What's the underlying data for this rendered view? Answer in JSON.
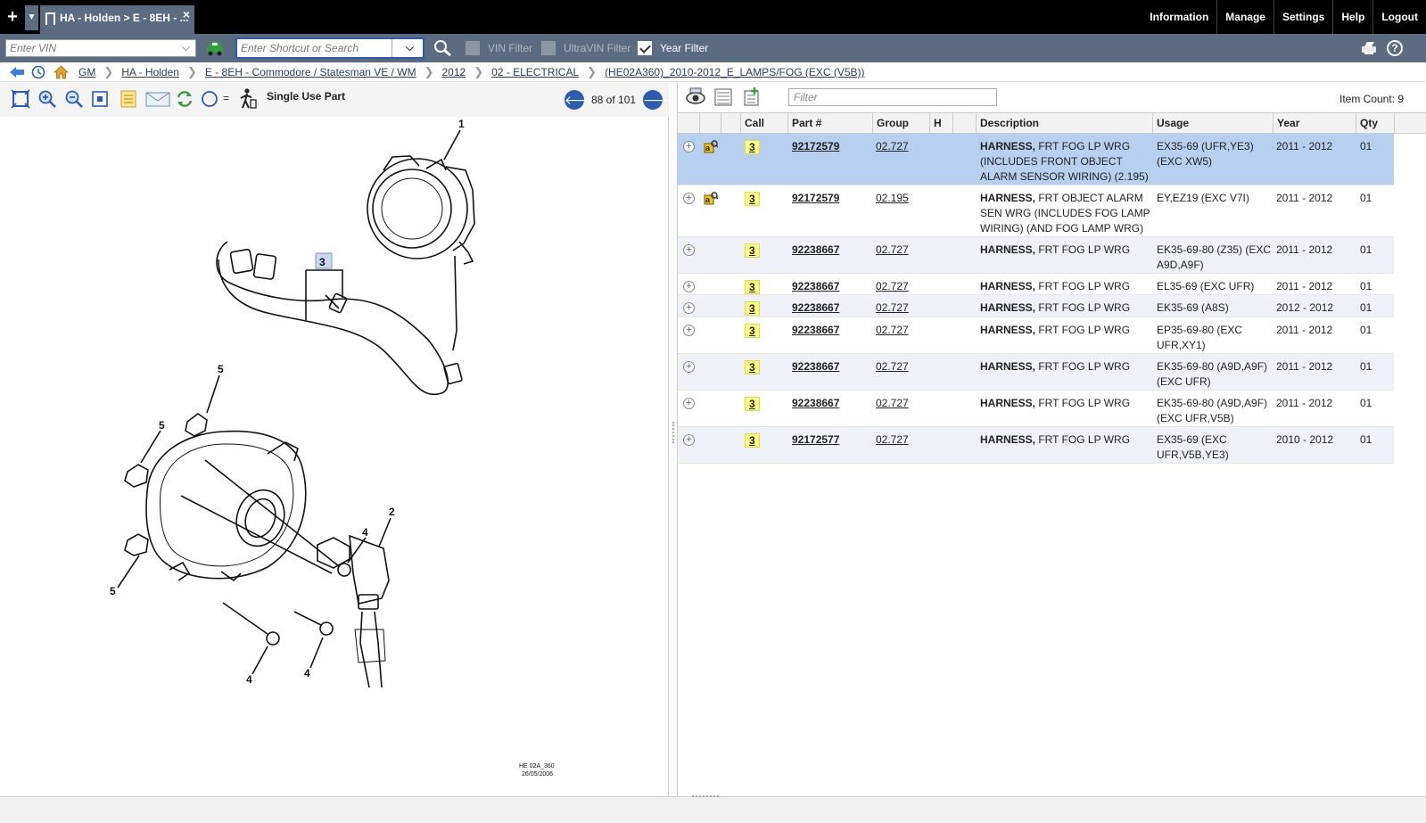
{
  "tab": {
    "title": "HA - Holden > E - 8EH - ...",
    "close": "×",
    "add": "+"
  },
  "topnav": [
    "Information",
    "Manage",
    "Settings",
    "Help",
    "Logout"
  ],
  "vin": {
    "placeholder": "Enter VIN"
  },
  "search": {
    "placeholder": "Enter Shortcut or Search"
  },
  "filters": {
    "vin": "VIN Filter",
    "ultravin": "UltraVIN Filter",
    "year": "Year Filter"
  },
  "breadcrumb": [
    "GM",
    "HA - Holden",
    "E - 8EH - Commodore / Statesman VE / WM",
    "2012",
    "02 - ELECTRICAL",
    "(HE02A360)_2010-2012_E_LAMPS/FOG (EXC (V5B))"
  ],
  "left_toolbar": {
    "single_use": "Single Use Part",
    "page": "88 of 101",
    "equals": "="
  },
  "diagram": {
    "callouts": [
      "1",
      "3",
      "5",
      "5",
      "4",
      "2",
      "5",
      "4",
      "4"
    ],
    "code": "HE 02A_360",
    "date": "26/05/2006"
  },
  "right_toolbar": {
    "filter_placeholder": "Filter",
    "item_count": "Item Count: 9"
  },
  "columns": [
    "Call",
    "Part #",
    "Group",
    "H",
    "Description",
    "Usage",
    "Year",
    "Qty"
  ],
  "rows": [
    {
      "call": "3",
      "part": "92172579",
      "group": "02.727",
      "desc_bold": "HARNESS,",
      "desc": " FRT FOG LP WRG (INCLUDES FRONT OBJECT ALARM SENSOR WIRING) (2.195)",
      "usage": "EX35-69 (UFR,YE3) (EXC XW5)",
      "year": "2011 - 2012",
      "qty": "01",
      "kb": true,
      "selected": true
    },
    {
      "call": "3",
      "part": "92172579",
      "group": "02.195",
      "desc_bold": "HARNESS,",
      "desc": " FRT OBJECT ALARM SEN WRG (INCLUDES FOG LAMP WIRING) (AND FOG LAMP WRG)",
      "usage": "EY,EZ19 (EXC V7I)",
      "year": "2011 - 2012",
      "qty": "01",
      "kb": true
    },
    {
      "call": "3",
      "part": "92238667",
      "group": "02.727",
      "desc_bold": "HARNESS,",
      "desc": " FRT FOG LP WRG",
      "usage": "EK35-69-80 (Z35) (EXC A9D,A9F)",
      "year": "2011 - 2012",
      "qty": "01"
    },
    {
      "call": "3",
      "part": "92238667",
      "group": "02.727",
      "desc_bold": "HARNESS,",
      "desc": " FRT FOG LP WRG",
      "usage": "EL35-69 (EXC UFR)",
      "year": "2011 - 2012",
      "qty": "01"
    },
    {
      "call": "3",
      "part": "92238667",
      "group": "02.727",
      "desc_bold": "HARNESS,",
      "desc": " FRT FOG LP WRG",
      "usage": "EK35-69 (A8S)",
      "year": "2012 - 2012",
      "qty": "01"
    },
    {
      "call": "3",
      "part": "92238667",
      "group": "02.727",
      "desc_bold": "HARNESS,",
      "desc": " FRT FOG LP WRG",
      "usage": "EP35-69-80 (EXC UFR,XY1)",
      "year": "2011 - 2012",
      "qty": "01"
    },
    {
      "call": "3",
      "part": "92238667",
      "group": "02.727",
      "desc_bold": "HARNESS,",
      "desc": " FRT FOG LP WRG",
      "usage": "EK35-69-80 (A9D,A9F) (EXC UFR)",
      "year": "2011 - 2012",
      "qty": "01"
    },
    {
      "call": "3",
      "part": "92238667",
      "group": "02.727",
      "desc_bold": "HARNESS,",
      "desc": " FRT FOG LP WRG",
      "usage": "EK35-69-80 (A9D,A9F) (EXC UFR,V5B)",
      "year": "2011 - 2012",
      "qty": "01"
    },
    {
      "call": "3",
      "part": "92172577",
      "group": "02.727",
      "desc_bold": "HARNESS,",
      "desc": " FRT FOG LP WRG",
      "usage": "EX35-69 (EXC UFR,V5B,YE3)",
      "year": "2010 - 2012",
      "qty": "01"
    }
  ]
}
